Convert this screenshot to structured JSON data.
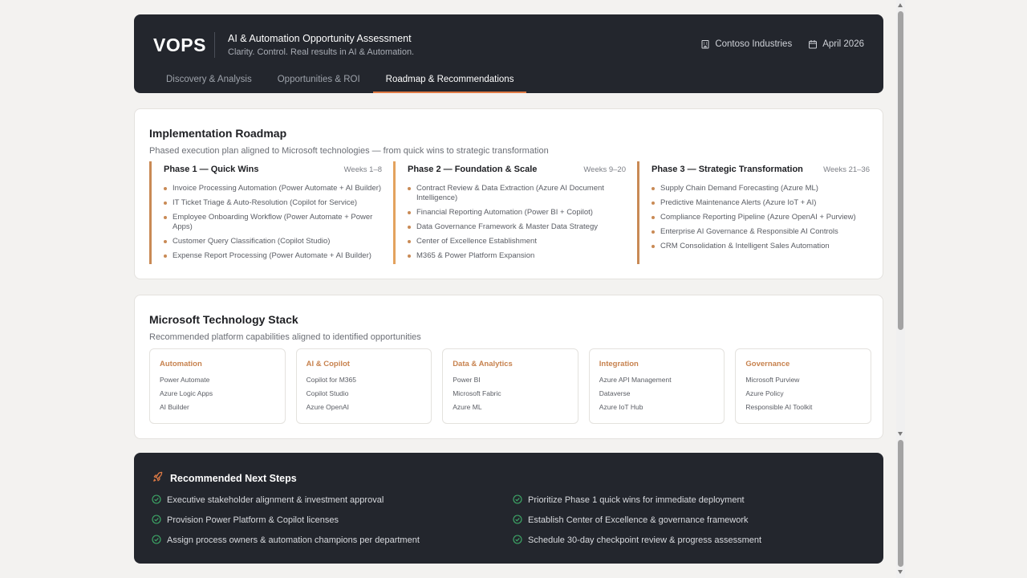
{
  "header": {
    "logo": "VOPS",
    "title": "AI & Automation Opportunity Assessment",
    "subtitle": "Clarity. Control. Real results in AI & Automation.",
    "company": "Contoso Industries",
    "date": "April 2026",
    "tabs": [
      {
        "label": "Discovery & Analysis",
        "active": false
      },
      {
        "label": "Opportunities & ROI",
        "active": false
      },
      {
        "label": "Roadmap & Recommendations",
        "active": true
      }
    ]
  },
  "roadmap": {
    "title": "Implementation Roadmap",
    "subtitle": "Phased execution plan aligned to Microsoft technologies — from quick wins to strategic transformation",
    "phases": [
      {
        "name": "Phase 1 — Quick Wins",
        "weeks": "Weeks 1–8",
        "items": [
          "Invoice Processing Automation (Power Automate + AI Builder)",
          "IT Ticket Triage & Auto-Resolution (Copilot for Service)",
          "Employee Onboarding Workflow (Power Automate + Power Apps)",
          "Customer Query Classification (Copilot Studio)",
          "Expense Report Processing (Power Automate + AI Builder)"
        ]
      },
      {
        "name": "Phase 2 — Foundation & Scale",
        "weeks": "Weeks 9–20",
        "items": [
          "Contract Review & Data Extraction (Azure AI Document Intelligence)",
          "Financial Reporting Automation (Power BI + Copilot)",
          "Data Governance Framework & Master Data Strategy",
          "Center of Excellence Establishment",
          "M365 & Power Platform Expansion"
        ]
      },
      {
        "name": "Phase 3 — Strategic Transformation",
        "weeks": "Weeks 21–36",
        "items": [
          "Supply Chain Demand Forecasting (Azure ML)",
          "Predictive Maintenance Alerts (Azure IoT + AI)",
          "Compliance Reporting Pipeline (Azure OpenAI + Purview)",
          "Enterprise AI Governance & Responsible AI Controls",
          "CRM Consolidation & Intelligent Sales Automation"
        ]
      }
    ]
  },
  "stack": {
    "title": "Microsoft Technology Stack",
    "subtitle": "Recommended platform capabilities aligned to identified opportunities",
    "groups": [
      {
        "title": "Automation",
        "items": [
          "Power Automate",
          "Azure Logic Apps",
          "AI Builder"
        ]
      },
      {
        "title": "AI & Copilot",
        "items": [
          "Copilot for M365",
          "Copilot Studio",
          "Azure OpenAI"
        ]
      },
      {
        "title": "Data & Analytics",
        "items": [
          "Power BI",
          "Microsoft Fabric",
          "Azure ML"
        ]
      },
      {
        "title": "Integration",
        "items": [
          "Azure API Management",
          "Dataverse",
          "Azure IoT Hub"
        ]
      },
      {
        "title": "Governance",
        "items": [
          "Microsoft Purview",
          "Azure Policy",
          "Responsible AI Toolkit"
        ]
      }
    ]
  },
  "next_steps": {
    "title": "Recommended Next Steps",
    "items": [
      "Executive stakeholder alignment & investment approval",
      "Prioritize Phase 1 quick wins for immediate deployment",
      "Provision Power Platform & Copilot licenses",
      "Establish Center of Excellence & governance framework",
      "Assign process owners & automation champions per department",
      "Schedule 30-day checkpoint review & progress assessment"
    ]
  },
  "colors": {
    "accent": "#e07b45",
    "dark_panel": "#23262d",
    "check": "#3fae6a"
  }
}
